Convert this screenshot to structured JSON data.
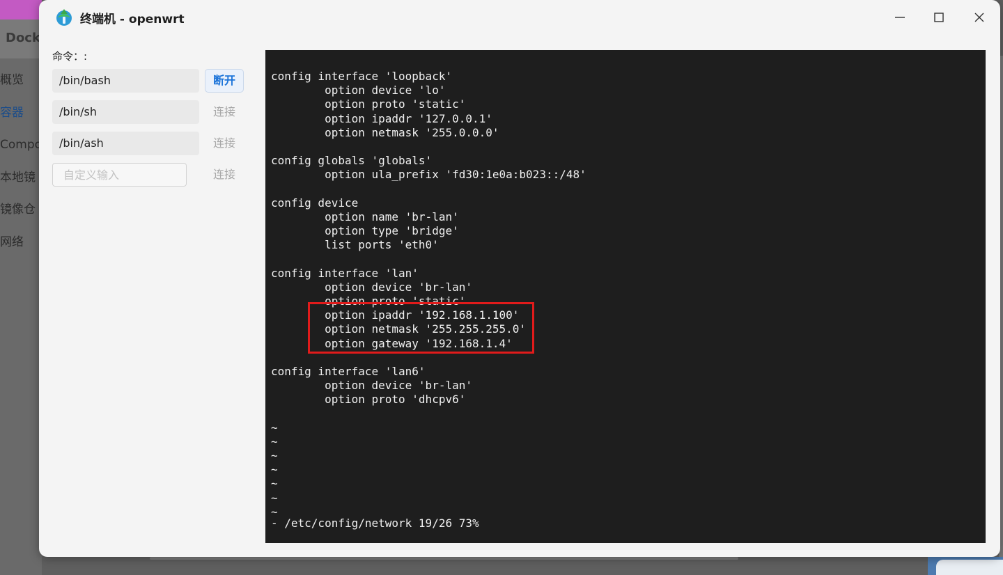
{
  "background_app": {
    "title": "Docke",
    "nav_items": [
      "概览",
      "容器",
      "Compo",
      "本地镜",
      "镜像仓",
      "网络"
    ],
    "active_nav_index": 1
  },
  "window": {
    "title": "终端机 - openwrt",
    "icon": "openwrt-terminal-icon",
    "controls": {
      "minimize": "minimize-icon",
      "maximize": "maximize-icon",
      "close": "close-icon"
    }
  },
  "commands": {
    "label": "命令：:",
    "items": [
      {
        "command": "/bin/bash",
        "action": "断开",
        "connected": true
      },
      {
        "command": "/bin/sh",
        "action": "连接",
        "connected": false
      },
      {
        "command": "/bin/ash",
        "action": "连接",
        "connected": false
      }
    ],
    "custom": {
      "placeholder": "自定义输入",
      "value": "",
      "action": "连接"
    }
  },
  "terminal": {
    "lines": [
      "config interface 'loopback'",
      "        option device 'lo'",
      "        option proto 'static'",
      "        option ipaddr '127.0.0.1'",
      "        option netmask '255.0.0.0'",
      "",
      "config globals 'globals'",
      "        option ula_prefix 'fd30:1e0a:b023::/48'",
      "",
      "config device",
      "        option name 'br-lan'",
      "        option type 'bridge'",
      "        list ports 'eth0'",
      "",
      "config interface 'lan'",
      "        option device 'br-lan'",
      "        option proto 'static'",
      "        option ipaddr '192.168.1.100'",
      "        option netmask '255.255.255.0'",
      "        option gateway '192.168.1.4'",
      "",
      "config interface 'lan6'",
      "        option device 'br-lan'",
      "        option proto 'dhcpv6'",
      "",
      "~",
      "~",
      "~",
      "~",
      "~",
      "~",
      "~"
    ],
    "status_line": "- /etc/config/network 19/26 73%",
    "highlight_color": "#e11b1b"
  },
  "colors": {
    "terminal_bg": "#1e1e1e",
    "terminal_fg": "#f0f0f0",
    "accent": "#1a73d9",
    "dialog_bg": "#f4f4f4"
  }
}
